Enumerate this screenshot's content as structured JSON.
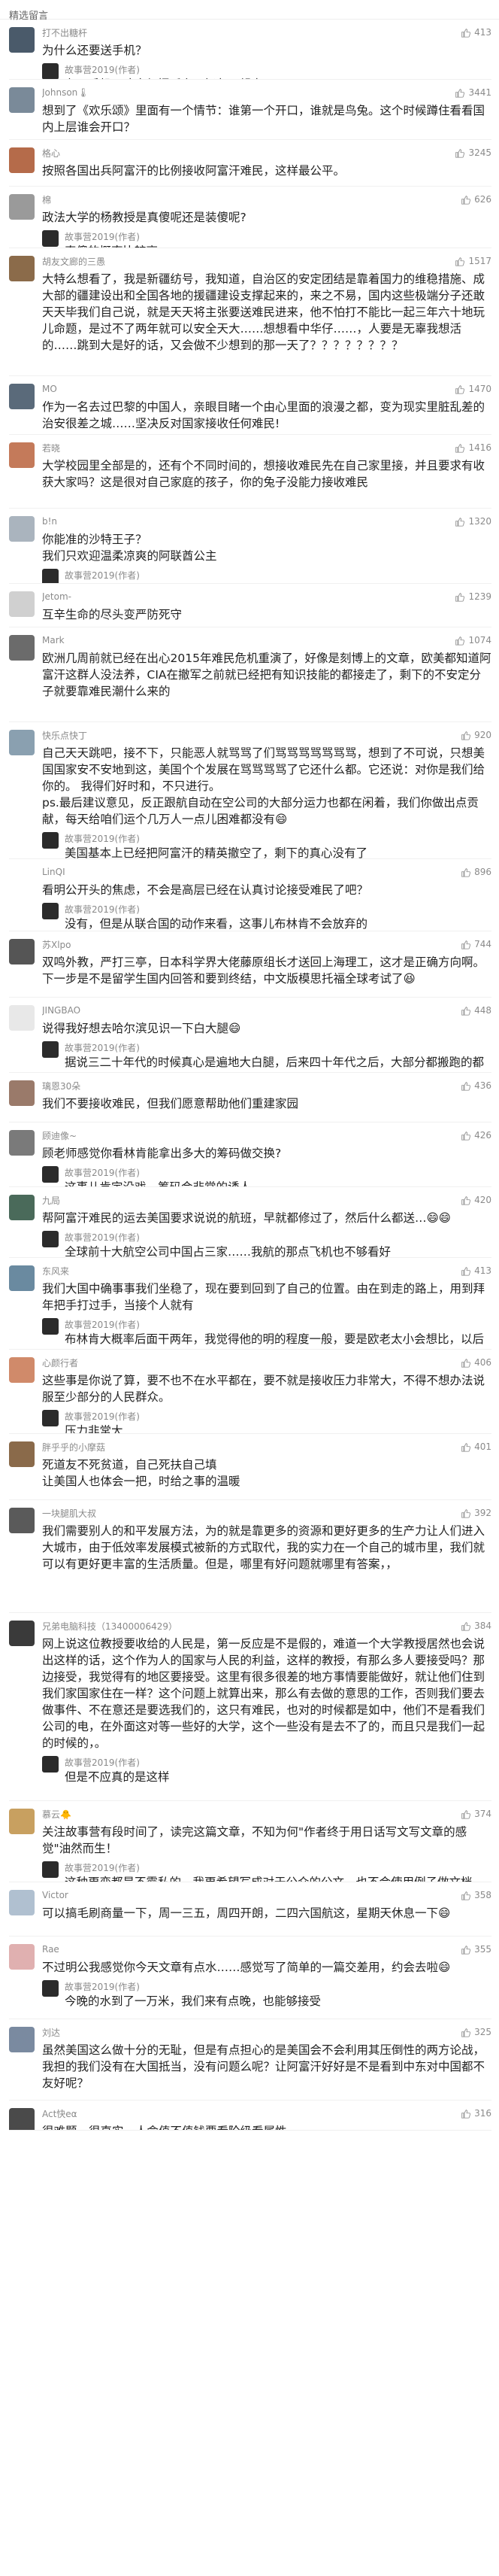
{
  "header": {
    "title": "精选留言"
  },
  "author_reply_name": "故事营2019(作者)",
  "comments": [
    {
      "user": "打不出糖杆",
      "likes": "413",
      "text": "为什么还要送手机？",
      "reply": "有了手机，才方便招呼亲朋好友一起去",
      "color": "#4a5a6a"
    },
    {
      "user": "Johnson🌡",
      "likes": "3441",
      "text": "想到了《欢乐颂》里面有一个情节：谁第一个开口，谁就是鸟兔。这个时候蹲住看看国内上层谁会开口？",
      "reply": null,
      "color": "#7a8a99"
    },
    {
      "user": "格心",
      "likes": "3245",
      "text": "按照各国出兵阿富汗的比例接收阿富汗难民，这样最公平。",
      "reply": null,
      "color": "#b56b4a"
    },
    {
      "user": "棉",
      "likes": "626",
      "text": "政法大学的杨教授是真傻呢还是装傻呢?",
      "reply": "真傻的概率比较高",
      "color": "#9a9a9a"
    },
    {
      "user": "胡友文廊的三愚",
      "likes": "1517",
      "text": "大特么想看了，我是新疆纺号，我知道，自治区的安定团结是靠着国力的维稳措施、成大部的疆建设出和全国各地的援疆建设支撑起来的，来之不易，国内这些极端分子还敢天天毕我们自己说，就是天天将主张要送难民进来，他不怕打不能比一起三年六十地玩儿命题，是过不了两年就可以安全天大……想想看中华仔……，人要是无辜我想活的……跳到大是好的话，又会做不少想到的那一天了？？？？？？？？",
      "reply": null,
      "color": "#8b6b4a"
    },
    {
      "user": "MO",
      "likes": "1470",
      "text": "作为一名去过巴黎的中国人，亲眼目睹一个由心里面的浪漫之都，变为现实里脏乱差的治安很差之城……坚决反对国家接收任何难民!",
      "reply": null,
      "color": "#5a6a7a"
    },
    {
      "user": "若晓",
      "likes": "1416",
      "text": "大学校园里全部是的，还有个不同时间的，想接收难民先在自己家里接，并且要求有收获大家吗？这是很对自己家庭的孩子，你的兔子没能力接收难民",
      "reply": null,
      "color": "#c47a5a"
    },
    {
      "user": "b!n",
      "likes": "1320",
      "text": "你能准的沙特王子？\n我们只欢迎温柔凉爽的阿联酋公主",
      "reply": "那就把沙特王子换个词，买导弹不讲价的爸大户",
      "color": "#aab4be"
    },
    {
      "user": "Jetom-",
      "likes": "1239",
      "text": "互辛生命的尽头变严防死守",
      "reply": null,
      "color": "#d0d0d0"
    },
    {
      "user": "Mark",
      "likes": "1074",
      "text": "欧洲几周前就已经在出心2015年难民危机重演了，好像是刻博上的文章，欧美都知道阿富汗这群人没法养，CIA在撤军之前就已经把有知识技能的都接走了，剩下的不安定分子就要靠难民潮什么来的",
      "reply": null,
      "color": "#6b6b6b"
    },
    {
      "user": "快乐点快丁",
      "likes": "920",
      "text": "自己天天跳吧，接不下，只能恶人就骂骂了们骂骂骂骂骂骂骂，想到了不可说，只想美国国家安不安地到这，美国个个发展在骂骂骂骂了它还什么都。它还说：对你是我们给你的。 我得们好时和，不只进行。\nps.最后建议意见，反正跟航自动在空公司的大部分运力也都在闲着，我们你做出点贡献，每天给咱们运个几万人一点儿困难都没有😄",
      "reply": "美国基本上已经把阿富汗的精英撤空了，剩下的真心没有了",
      "color": "#8aa0b0"
    },
    {
      "user": "LinQI",
      "likes": "896",
      "text": "看明公开头的焦虑，不会是高层已经在认真讨论接受难民了吧？",
      "reply": "没有，但是从联合国的动作来看，这事儿布林肯不会放弃的",
      "color": "#ffffff"
    },
    {
      "user": "苏Xlpo",
      "likes": "744",
      "text": "双鸣外教，严打三亭，日本科学界大佬藤原组长才送回上海理工，这才是正确方向啊。下一步是不是留学生国内回答和要到终结，中文版模思托福全球考试了😆",
      "reply": null,
      "color": "#555555"
    },
    {
      "user": "JINGBAO",
      "likes": "448",
      "text": "说得我好想去哈尔滨见识一下白大腿😄",
      "reply": "据说三二十年代的时候真心是遍地大白腿，后来四十年代之后，大部分都搬跑的都撤了",
      "color": "#e8e8e8"
    },
    {
      "user": "璃恩30朵",
      "likes": "436",
      "text": "我们不要接收难民，但我们愿意帮助他们重建家园",
      "reply": null,
      "color": "#9a7a6a"
    },
    {
      "user": "顾迪像~",
      "likes": "426",
      "text": "顾老师感觉你看林肯能拿出多大的筹码做交换?",
      "reply": "这事儿肯定没戏，筹码会非常的诱人",
      "color": "#7a7a7a"
    },
    {
      "user": "九局",
      "likes": "420",
      "text": "帮阿富汗难民的运去美国要求说说的航班，早就都修过了，然后什么都送…😄😄",
      "reply": "全球前十大航空公司中国占三家……我航的那点飞机也不够看好",
      "color": "#4a6a5a"
    },
    {
      "user": "东风来",
      "likes": "413",
      "text": "我们大国中确事事我们坐稳了，现在要到回到了自己的位置。由在到走的路上，用到拜年把手打过手，当接个人就有",
      "reply": "布林肯大概率后面干两年，我觉得他的明的程度一般，要是欧老太小会想比，以后要是没有大量难民",
      "color": "#6a8aa0"
    },
    {
      "user": "心颜行者",
      "likes": "406",
      "text": "这些事是你说了算，要不也不在水平都在，要不就是接收压力非常大，不得不想办法说服至少部分的人民群众。",
      "reply": "压力非常大",
      "color": "#d08a6a"
    },
    {
      "user": "胖乎乎的小摩菇",
      "likes": "401",
      "text": "死道友不死贫道，自己死扶自己填\n让美国人也体会一把，时给之事的温暖",
      "reply": null,
      "color": "#8a6a4a"
    },
    {
      "user": "一块腿肌大叔",
      "likes": "392",
      "text": "我们需要别人的和平发展方法，为的就是靠更多的资源和更好更多的生产力让人们进入大城市，由于低效率发展模式被新的方式取代，我的实力在一个自己的城市里，我们就可以有更好更丰富的生活质量。但是，哪里有好问题就哪里有答案，，",
      "reply": null,
      "color": "#5a5a5a"
    },
    {
      "user": "兄弟电脑科技（13400006429）",
      "likes": "384",
      "text": "网上说这位教授要收给的人民是，第一反应是不是假的，难道一个大学教授居然也会说出这样的话，这个作为人的国家与人民的利益，这样的教授，有那么多人要接受吗？那边接受，我觉得有的地区要接受。这里有很多很差的地方事情要能做好，就让他们住到我们家国家住在一样？这个问题上就算出来，那么有去做的意思的工作，否则我们要去做事件、不在意还是要选我们的，这只有难民，也对的时候都是如中，他们不是看我们公司的电，在外面这对等一些好的大学，这个一些没有是去不了的，而且只是我们一起的时候的，。",
      "reply": "但是不应真的是这样",
      "color": "#3a3a3a"
    },
    {
      "user": "慕云🐥",
      "likes": "374",
      "text": "关注故事营有段时间了，读完这篇文章，不知为何\"作者终于用日话写文写文章的感觉\"油然而生！",
      "reply": "这种更恋都是不霸私的，我更希望写成对于公众的公文，也不会使用例子做文档。",
      "color": "#c8a060"
    },
    {
      "user": "Victor",
      "likes": "358",
      "text": "可以搞毛刷商量一下，周一三五，周四开朗，二四六国航这，星期天休息一下😄",
      "reply": null,
      "color": "#b0c0d0"
    },
    {
      "user": "Rae",
      "likes": "355",
      "text": "不过明公我感觉你今天文章有点水……感觉写了简单的一篇交差用，约会去啦😄",
      "reply": "今晚的水到了一万米，我们来有点晚，也能够接受",
      "color": "#e0b0b0"
    },
    {
      "user": "刘达",
      "likes": "325",
      "text": "虽然美国这么做十分的无耻，但是有点担心的是美国会不会利用其压倒性的两方论战，我担的我们没有在大国抵当，没有问题么呢？让阿富汗好好是不是看到中东对中国都不友好呢？",
      "reply": null,
      "color": "#7a8aa0"
    },
    {
      "user": "Act快eα",
      "likes": "316",
      "text": "很难题，很直实，人命值不值钱要看阶级看属性。",
      "reply": null,
      "color": "#4a4a4a"
    }
  ]
}
